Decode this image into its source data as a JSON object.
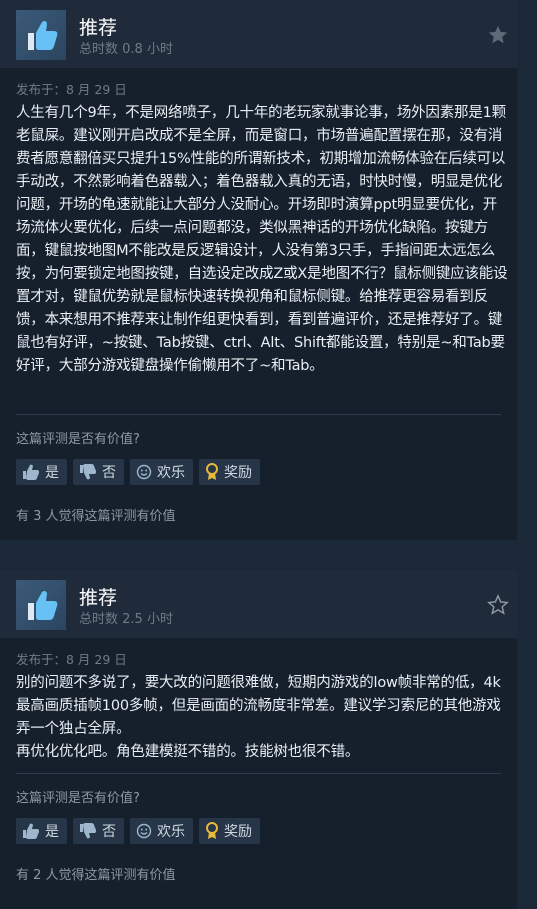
{
  "reviews": [
    {
      "recommendation": "推荐",
      "hours": "总时数 0.8 小时",
      "posted": "发布于：8 月 29 日",
      "text": "人生有几个9年，不是网络喷子，几十年的老玩家就事论事，场外因素那是1颗老鼠屎。建议刚开启改成不是全屏，而是窗口，市场普遍配置摆在那，没有消费者愿意翻倍买只提升15%性能的所谓新技术，初期增加流畅体验在后续可以手动改，不然影响着色器载入；着色器载入真的无语，时快时慢，明显是优化问题，开场的龟速就能让大部分人没耐心。开场即时演算ppt明显要优化，开场流体火要优化，后续一点问题都没，类似黑神话的开场优化缺陷。按键方面，键鼠按地图M不能改是反逻辑设计，人没有第3只手，手指间距太远怎么按，为何要锁定地图按键，自选设定改成Z或X是地图不行？鼠标侧键应该能设置才对，键鼠优势就是鼠标快速转换视角和鼠标侧键。给推荐更容易看到反馈，本来想用不推荐来让制作组更快看到，看到普遍评价，还是推荐好了。键鼠也有好评，~按键、Tab按键、ctrl、Alt、Shift都能设置，特别是~和Tab要好评，大部分游戏键盘操作偷懒用不了~和Tab。",
      "question": "这篇评测是否有价值?",
      "yes": "是",
      "no": "否",
      "funny": "欢乐",
      "award": "奖励",
      "helpful": "有 3 人觉得这篇评测有价值"
    },
    {
      "recommendation": "推荐",
      "hours": "总时数 2.5 小时",
      "posted": "发布于：8 月 29 日",
      "text": "别的问题不多说了，要大改的问题很难做，短期内游戏的low帧非常的低，4k最高画质插帧100多帧，但是画面的流畅度非常差。建议学习索尼的其他游戏弄一个独占全屏。\n再优化优化吧。角色建模挺不错的。技能树也很不错。",
      "question": "这篇评测是否有价值?",
      "yes": "是",
      "no": "否",
      "funny": "欢乐",
      "award": "奖励",
      "helpful": "有 2 人觉得这篇评测有价值"
    }
  ],
  "colors": {
    "background": "#1b2838",
    "card": "#16202d",
    "header": "#1f2b3a",
    "button": "#263648",
    "award_icon": "#e8b93a"
  },
  "icons": [
    "thumbs-up-icon",
    "star-icon",
    "thumbs-down-icon",
    "smiley-icon",
    "award-icon"
  ]
}
